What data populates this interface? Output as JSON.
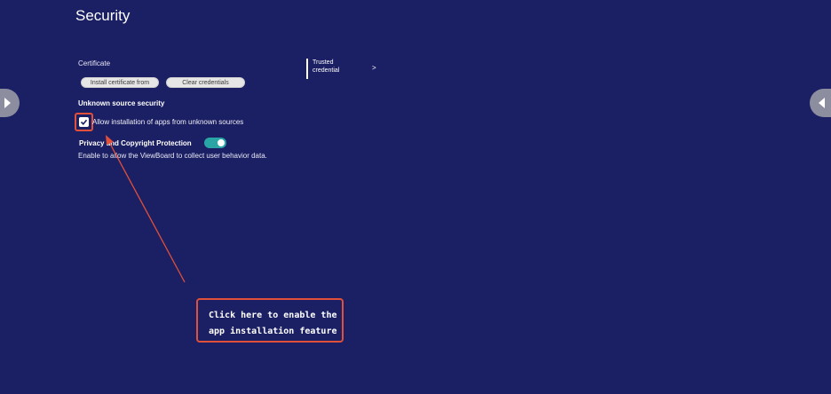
{
  "page": {
    "title": "Security"
  },
  "certificate": {
    "label": "Certificate",
    "install_button": "Install certificate from",
    "clear_button": "Clear credentials",
    "trusted_line1": "Trusted",
    "trusted_line2": "credential",
    "trusted_chevron": ">"
  },
  "unknown_source": {
    "heading": "Unknown source security",
    "checkbox_label": "Allow installation of apps from unknown sources",
    "checked": true
  },
  "privacy": {
    "title": "Privacy and Copyright Protection",
    "description": "Enable to allow the ViewBoard to collect user behavior data.",
    "toggle_on": true
  },
  "callout": {
    "line1": "Click here to enable the",
    "line2": "app installation feature"
  },
  "colors": {
    "background": "#1b1f63",
    "highlight": "#e0503a",
    "toggle": "#2aa5a5"
  },
  "icons": {
    "nav_left": "play-left-icon",
    "nav_right": "play-right-icon",
    "check": "checkmark-icon"
  }
}
